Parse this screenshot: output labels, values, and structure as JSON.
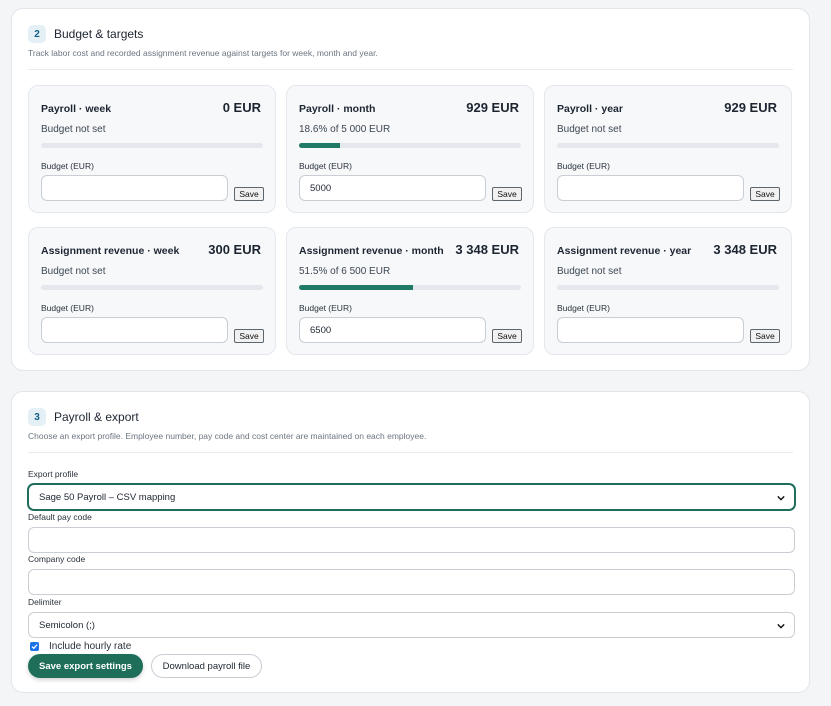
{
  "budget_section": {
    "number": "2",
    "title": "Budget & targets",
    "description": "Track labor cost and recorded assignment revenue against targets for week, month and year.",
    "cards": [
      {
        "title": "Payroll · week",
        "value": "0 EUR",
        "status": "Budget not set",
        "progress_percent": 0,
        "budget_label": "Budget (EUR)",
        "budget_value": "",
        "save_label": "Save"
      },
      {
        "title": "Payroll · month",
        "value": "929 EUR",
        "status": "18.6% of 5 000 EUR",
        "progress_percent": 18.6,
        "budget_label": "Budget (EUR)",
        "budget_value": "5000",
        "save_label": "Save"
      },
      {
        "title": "Payroll · year",
        "value": "929 EUR",
        "status": "Budget not set",
        "progress_percent": 0,
        "budget_label": "Budget (EUR)",
        "budget_value": "",
        "save_label": "Save"
      },
      {
        "title": "Assignment revenue · week",
        "value": "300 EUR",
        "status": "Budget not set",
        "progress_percent": 0,
        "budget_label": "Budget (EUR)",
        "budget_value": "",
        "save_label": "Save"
      },
      {
        "title": "Assignment revenue · month",
        "value": "3 348 EUR",
        "status": "51.5% of 6 500 EUR",
        "progress_percent": 51.5,
        "budget_label": "Budget (EUR)",
        "budget_value": "6500",
        "save_label": "Save"
      },
      {
        "title": "Assignment revenue · year",
        "value": "3 348 EUR",
        "status": "Budget not set",
        "progress_percent": 0,
        "budget_label": "Budget (EUR)",
        "budget_value": "",
        "save_label": "Save"
      }
    ]
  },
  "payroll_section": {
    "number": "3",
    "title": "Payroll & export",
    "description": "Choose an export profile. Employee number, pay code and cost center are maintained on each employee.",
    "export_profile": {
      "label": "Export profile",
      "value": "Sage 50 Payroll – CSV mapping"
    },
    "default_pay_code": {
      "label": "Default pay code",
      "value": ""
    },
    "company_code": {
      "label": "Company code",
      "value": ""
    },
    "delimiter": {
      "label": "Delimiter",
      "value": "Semicolon (;)"
    },
    "include_hourly_rate": {
      "label": "Include hourly rate",
      "checked": true
    },
    "save_button": "Save export settings",
    "download_button": "Download payroll file"
  },
  "colors": {
    "accent": "#1e6e59",
    "progress": "#1f7a68",
    "checkbox": "#1a73e8"
  },
  "icons": [
    "chevron-down-icon",
    "checkmark-icon"
  ]
}
